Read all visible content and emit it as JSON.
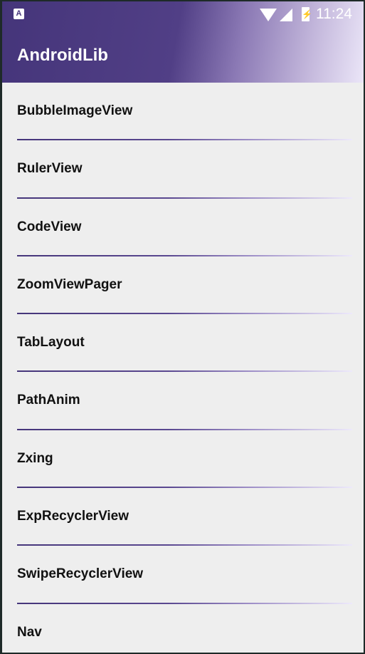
{
  "status_bar": {
    "app_icon": "A",
    "wifi_icon": "wifi-icon",
    "signal_icon": "signal-icon",
    "battery_icon": "battery-charging-icon",
    "time": "11:24"
  },
  "toolbar": {
    "title": "AndroidLib"
  },
  "colors": {
    "primary": "#45357a",
    "background": "#eeeeee"
  },
  "list": {
    "items": [
      {
        "label": "BubbleImageView"
      },
      {
        "label": "RulerView"
      },
      {
        "label": "CodeView"
      },
      {
        "label": "ZoomViewPager"
      },
      {
        "label": "TabLayout"
      },
      {
        "label": "PathAnim"
      },
      {
        "label": "Zxing"
      },
      {
        "label": "ExpRecyclerView"
      },
      {
        "label": "SwipeRecyclerView"
      },
      {
        "label": "Nav"
      }
    ]
  }
}
